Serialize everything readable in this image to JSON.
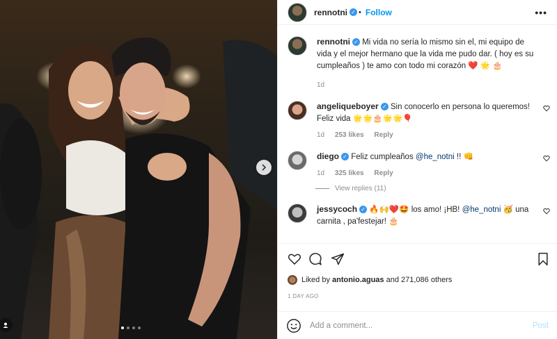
{
  "post": {
    "author": "rennotni",
    "follow_label": "Follow",
    "more_label": "•••",
    "caption": "Mi vida no sería lo mismo sin el, mi equipo de vida y el mejor hermano que la vida me pudo dar. ( hoy es su cumpleaños ) te amo con todo mi corazón ❤️ 🌟 🎂",
    "caption_time": "1d",
    "carousel": {
      "total": 4,
      "active": 1
    }
  },
  "comments": [
    {
      "user": "angeliqueboyer",
      "text": "Sin conocerlo en persona lo queremos! Feliz vida 🌟🌟🎂🌟🌟🎈",
      "time": "1d",
      "likes": "253 likes",
      "reply": "Reply"
    },
    {
      "user": "diego",
      "text_pre": "Feliz cumpleaños ",
      "mention": "@he_notni",
      "text_post": " !! 👊",
      "time": "1d",
      "likes": "325 likes",
      "reply": "Reply",
      "view_replies": "View replies (11)"
    },
    {
      "user": "jessycoch",
      "text_pre": "🔥🙌❤️🤩 los amo! ¡HB! ",
      "mention": "@he_notni",
      "text_post": " 🥳 una carnita , pa'festejar! 🎂"
    }
  ],
  "likes": {
    "prefix": "Liked by ",
    "user": "antonio.aguas",
    "suffix": " and 271,086 others"
  },
  "date_label": "1 DAY AGO",
  "add_comment": {
    "placeholder": "Add a comment...",
    "post_label": "Post"
  },
  "colors": {
    "accent": "#0095f6",
    "verified": "#3897f0",
    "post_disabled": "#b2dffc"
  }
}
